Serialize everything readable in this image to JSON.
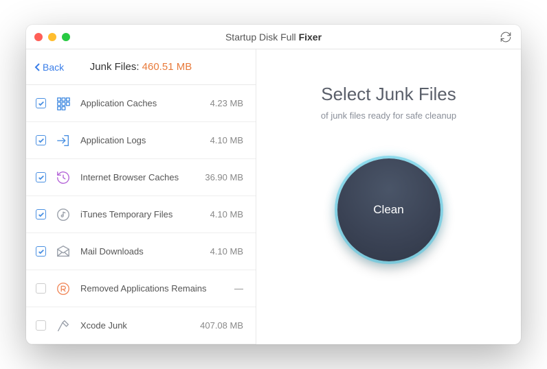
{
  "window": {
    "title_prefix": "Startup Disk Full ",
    "title_bold": "Fixer"
  },
  "sidebar": {
    "back_label": "Back",
    "header_label": "Junk Files: ",
    "header_size": "460.51 MB",
    "items": [
      {
        "label": "Application Caches",
        "size": "4.23 MB",
        "checked": true,
        "icon": "grid",
        "color": "#4a90e2"
      },
      {
        "label": "Application Logs",
        "size": "4.10 MB",
        "checked": true,
        "icon": "arrow-in",
        "color": "#4a90e2"
      },
      {
        "label": "Internet Browser Caches",
        "size": "36.90 MB",
        "checked": true,
        "icon": "history",
        "color": "#b565d8"
      },
      {
        "label": "iTunes Temporary Files",
        "size": "4.10 MB",
        "checked": true,
        "icon": "music",
        "color": "#9aa0aa"
      },
      {
        "label": "Mail Downloads",
        "size": "4.10 MB",
        "checked": true,
        "icon": "mail",
        "color": "#9aa0aa"
      },
      {
        "label": "Removed Applications Remains",
        "size": "—",
        "checked": false,
        "icon": "letter-r",
        "color": "#f08a5d"
      },
      {
        "label": "Xcode Junk",
        "size": "407.08 MB",
        "checked": false,
        "icon": "hammer",
        "color": "#9aa0aa"
      }
    ]
  },
  "main": {
    "title": "Select Junk Files",
    "subtitle": "of junk files ready for safe cleanup",
    "clean_label": "Clean"
  }
}
